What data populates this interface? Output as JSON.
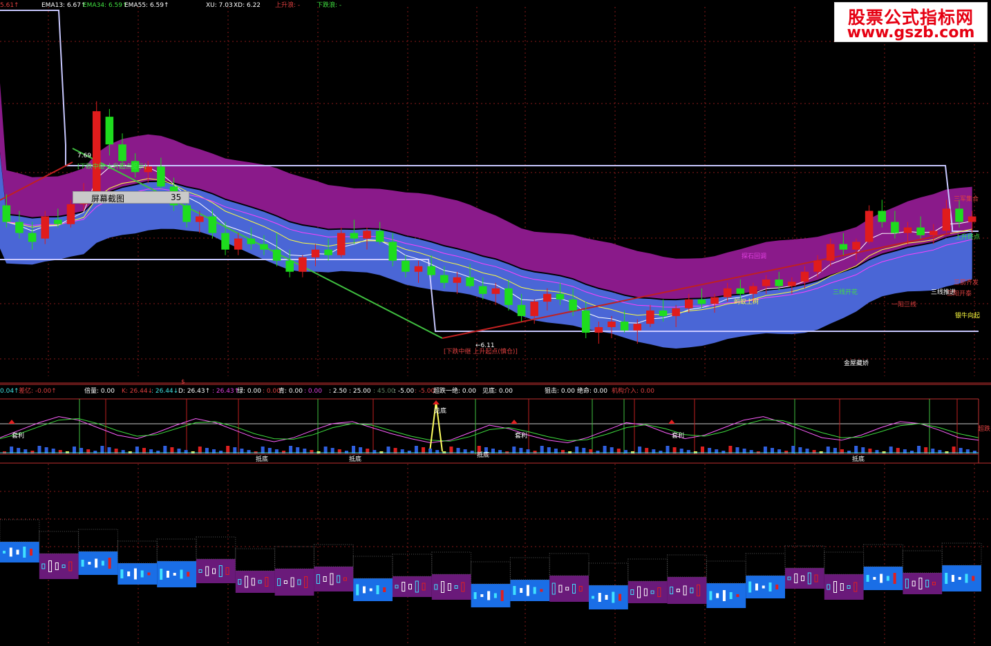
{
  "header": {
    "items": [
      {
        "text": "5.61↑",
        "color": "#e04040"
      },
      {
        "text": "EMA13: 6.67↑",
        "color": "#ffffff"
      },
      {
        "text": "EMA34: 6.59↑",
        "color": "#40e040"
      },
      {
        "text": "EMA55: 6.59↑",
        "color": "#ffffff"
      },
      {
        "text": "XU: 7.03",
        "color": "#ffffff"
      },
      {
        "text": "XD: 6.22",
        "color": "#ffffff"
      },
      {
        "text": "上升浪: -",
        "color": "#e04040"
      },
      {
        "text": "下跌浪: -",
        "color": "#40e040"
      }
    ]
  },
  "watermark": {
    "line1": "股票公式指标网",
    "line2": "www.gszb.com"
  },
  "tooltip": {
    "label": "屏幕截图",
    "value": "35"
  },
  "indicator_header": {
    "items": [
      {
        "text": "0.04↑",
        "color": "#40e0e0"
      },
      {
        "text": "差亿: -0.00↑",
        "color": "#e04040"
      },
      {
        "text": "倍量: 0.00",
        "color": "#ffffff"
      },
      {
        "text": "K: 26.44↓",
        "color": "#e04040"
      },
      {
        "text": ": 26.44↓",
        "color": "#40e0e0"
      },
      {
        "text": "D: 26.43↑",
        "color": "#ffffff"
      },
      {
        "text": ": 26.43↑",
        "color": "#e040e0"
      },
      {
        "text": "绿: 0.00",
        "color": "#ffffff"
      },
      {
        "text": ": 0.00",
        "color": "#e04040"
      },
      {
        "text": "青: 0.00",
        "color": "#ffffff"
      },
      {
        "text": ": 0.00",
        "color": "#e040e0"
      },
      {
        "text": ": 2.50",
        "color": "#ffffff"
      },
      {
        "text": ": 25.00",
        "color": "#ffffff"
      },
      {
        "text": ": 45.00",
        "color": "#608060"
      },
      {
        "text": ": -5.00",
        "color": "#ffffff"
      },
      {
        "text": ": -5.00",
        "color": "#e04040"
      },
      {
        "text": "超跌一绝: 0.00",
        "color": "#ffffff"
      },
      {
        "text": "见底: 0.00",
        "color": "#ffffff"
      },
      {
        "text": "狙击: 0.00",
        "color": "#ffffff"
      },
      {
        "text": "绝命: 0.00",
        "color": "#ffffff"
      },
      {
        "text": "机构介入: 0.00",
        "color": "#e04040"
      }
    ]
  },
  "annotations": {
    "high_label": "7.69",
    "low_label": "←6.11",
    "dollar": "$",
    "main_labels": [
      {
        "text": "[下跌中继 上升起点提示]",
        "color": "#40e040"
      },
      {
        "text": "[下跌中继 上升起点(慎仓)]",
        "color": "#e04040"
      },
      {
        "text": "探石回调",
        "color": "#e040e0"
      },
      {
        "text": "蚂蚁上树",
        "color": "#ffff40"
      },
      {
        "text": "三线推进",
        "color": "#ffffff"
      },
      {
        "text": "三箭齐发",
        "color": "#e04040"
      },
      {
        "text": "三阳开泰",
        "color": "#e04040"
      },
      {
        "text": "一阳三线",
        "color": "#e04040"
      },
      {
        "text": "三军集合",
        "color": "#e04040"
      },
      {
        "text": "上升终点",
        "color": "#40e040"
      },
      {
        "text": "银牛向起",
        "color": "#ffff40"
      },
      {
        "text": "金屋藏娇",
        "color": "#ffffff"
      },
      {
        "text": "三线开花",
        "color": "#40e040"
      }
    ],
    "kdj_labels": [
      {
        "text": "套利"
      },
      {
        "text": "见底"
      },
      {
        "text": "套利"
      },
      {
        "text": "套利"
      },
      {
        "text": "抵底"
      },
      {
        "text": "抵底"
      },
      {
        "text": "抵底"
      },
      {
        "text": "抵底"
      },
      {
        "text": "超跌",
        "color": "#e04040"
      }
    ]
  },
  "colors": {
    "bull": "#e01c1c",
    "bear": "#1edc1e",
    "upper_band": "#8a1a8a",
    "lower_band": "#4a66d6",
    "ema13": "#ffffff",
    "ema34": "#ffff40",
    "ema55": "#ff40ff",
    "grid": "#8a1a1a"
  },
  "chart_data": [
    {
      "type": "candlestick",
      "title": "",
      "ylim": [
        5.9,
        7.9
      ],
      "candles": [
        [
          6.75,
          6.85,
          6.55,
          6.6
        ],
        [
          6.6,
          6.7,
          6.45,
          6.5
        ],
        [
          6.5,
          6.6,
          6.35,
          6.42
        ],
        [
          6.45,
          6.7,
          6.4,
          6.65
        ],
        [
          6.62,
          6.72,
          6.55,
          6.58
        ],
        [
          6.58,
          6.8,
          6.55,
          6.76
        ],
        [
          6.76,
          6.95,
          6.7,
          6.8
        ],
        [
          6.8,
          7.69,
          6.78,
          7.6
        ],
        [
          7.55,
          7.62,
          7.2,
          7.3
        ],
        [
          7.3,
          7.4,
          7.1,
          7.15
        ],
        [
          7.15,
          7.22,
          7.0,
          7.05
        ],
        [
          7.05,
          7.15,
          6.95,
          7.1
        ],
        [
          7.1,
          7.18,
          6.9,
          6.92
        ],
        [
          6.92,
          7.0,
          6.7,
          6.75
        ],
        [
          6.75,
          6.8,
          6.55,
          6.6
        ],
        [
          6.6,
          6.7,
          6.5,
          6.65
        ],
        [
          6.65,
          6.72,
          6.45,
          6.5
        ],
        [
          6.5,
          6.6,
          6.3,
          6.35
        ],
        [
          6.35,
          6.5,
          6.3,
          6.45
        ],
        [
          6.45,
          6.55,
          6.35,
          6.4
        ],
        [
          6.4,
          6.48,
          6.3,
          6.35
        ],
        [
          6.35,
          6.5,
          6.2,
          6.25
        ],
        [
          6.25,
          6.35,
          6.1,
          6.15
        ],
        [
          6.15,
          6.3,
          6.1,
          6.28
        ],
        [
          6.28,
          6.4,
          6.2,
          6.35
        ],
        [
          6.35,
          6.45,
          6.25,
          6.3
        ],
        [
          6.3,
          6.55,
          6.28,
          6.5
        ],
        [
          6.5,
          6.62,
          6.4,
          6.45
        ],
        [
          6.45,
          6.55,
          6.35,
          6.52
        ],
        [
          6.52,
          6.6,
          6.4,
          6.42
        ],
        [
          6.42,
          6.5,
          6.2,
          6.25
        ],
        [
          6.25,
          6.3,
          6.1,
          6.15
        ],
        [
          6.15,
          6.25,
          6.05,
          6.2
        ],
        [
          6.2,
          6.3,
          6.1,
          6.12
        ],
        [
          6.12,
          6.2,
          6.0,
          6.05
        ],
        [
          6.05,
          6.15,
          5.95,
          6.1
        ],
        [
          6.1,
          6.22,
          6.0,
          6.02
        ],
        [
          6.02,
          6.1,
          5.9,
          5.95
        ],
        [
          5.95,
          6.05,
          5.85,
          6.0
        ],
        [
          6.0,
          6.08,
          5.8,
          5.85
        ],
        [
          5.85,
          5.95,
          5.7,
          5.75
        ],
        [
          5.75,
          5.9,
          5.68,
          5.88
        ],
        [
          5.88,
          6.0,
          5.8,
          5.95
        ],
        [
          5.95,
          6.05,
          5.85,
          5.9
        ],
        [
          5.9,
          6.0,
          5.75,
          5.8
        ],
        [
          5.8,
          5.88,
          5.55,
          5.6
        ],
        [
          5.6,
          5.7,
          5.5,
          5.65
        ],
        [
          5.65,
          5.75,
          5.55,
          5.7
        ],
        [
          5.7,
          5.8,
          5.6,
          5.62
        ],
        [
          5.62,
          5.72,
          5.5,
          5.68
        ],
        [
          5.68,
          5.85,
          5.65,
          5.8
        ],
        [
          5.8,
          5.9,
          5.7,
          5.75
        ],
        [
          5.75,
          5.85,
          5.65,
          5.82
        ],
        [
          5.82,
          5.95,
          5.78,
          5.9
        ],
        [
          5.9,
          6.0,
          5.82,
          5.86
        ],
        [
          5.86,
          5.95,
          5.78,
          5.92
        ],
        [
          5.92,
          6.05,
          5.88,
          6.0
        ],
        [
          6.0,
          6.08,
          5.9,
          5.95
        ],
        [
          5.95,
          6.05,
          5.88,
          6.02
        ],
        [
          6.02,
          6.12,
          5.95,
          6.08
        ],
        [
          6.08,
          6.15,
          5.98,
          6.02
        ],
        [
          6.02,
          6.1,
          5.95,
          6.06
        ],
        [
          6.06,
          6.2,
          6.0,
          6.15
        ],
        [
          6.15,
          6.3,
          6.1,
          6.25
        ],
        [
          6.25,
          6.45,
          6.2,
          6.4
        ],
        [
          6.4,
          6.5,
          6.3,
          6.35
        ],
        [
          6.35,
          6.45,
          6.25,
          6.42
        ],
        [
          6.42,
          6.75,
          6.4,
          6.7
        ],
        [
          6.7,
          6.8,
          6.55,
          6.6
        ],
        [
          6.6,
          6.7,
          6.45,
          6.5
        ],
        [
          6.5,
          6.6,
          6.4,
          6.55
        ],
        [
          6.55,
          6.65,
          6.45,
          6.48
        ],
        [
          6.48,
          6.58,
          6.4,
          6.52
        ],
        [
          6.52,
          6.8,
          6.5,
          6.72
        ],
        [
          6.72,
          6.8,
          6.55,
          6.6
        ],
        [
          6.6,
          6.7,
          6.5,
          6.65
        ]
      ]
    },
    {
      "type": "line",
      "title": "",
      "ylim": [
        -10,
        110
      ],
      "series": [
        {
          "values": [
            30,
            45,
            60,
            72,
            65,
            50,
            35,
            28,
            40,
            55,
            68,
            60,
            45,
            30,
            22,
            30,
            45,
            58,
            62,
            50,
            38,
            28,
            20,
            25,
            40,
            55,
            48,
            35,
            25,
            20,
            30,
            45,
            60,
            55,
            40,
            28,
            35,
            50,
            65,
            72,
            60,
            45,
            30,
            25,
            35,
            50,
            62,
            58,
            45,
            30,
            25
          ]
        },
        {
          "values": [
            28,
            38,
            52,
            65,
            68,
            58,
            44,
            33,
            36,
            48,
            60,
            62,
            52,
            38,
            28,
            27,
            36,
            50,
            58,
            55,
            44,
            33,
            25,
            23,
            32,
            46,
            50,
            42,
            32,
            24,
            26,
            37,
            50,
            56,
            48,
            36,
            33,
            42,
            56,
            66,
            64,
            52,
            40,
            30,
            31,
            42,
            54,
            58,
            50,
            38,
            30
          ]
        }
      ]
    },
    {
      "type": "bar",
      "title": "",
      "note": "segmented momentum blocks with small sub-bars",
      "blocks": [
        1,
        -1,
        1,
        1,
        1,
        -1,
        -1,
        -1,
        -1,
        1,
        -1,
        -1,
        1,
        1,
        -1,
        1,
        -1,
        -1,
        1,
        1,
        -1,
        -1,
        1,
        -1,
        1
      ]
    }
  ]
}
